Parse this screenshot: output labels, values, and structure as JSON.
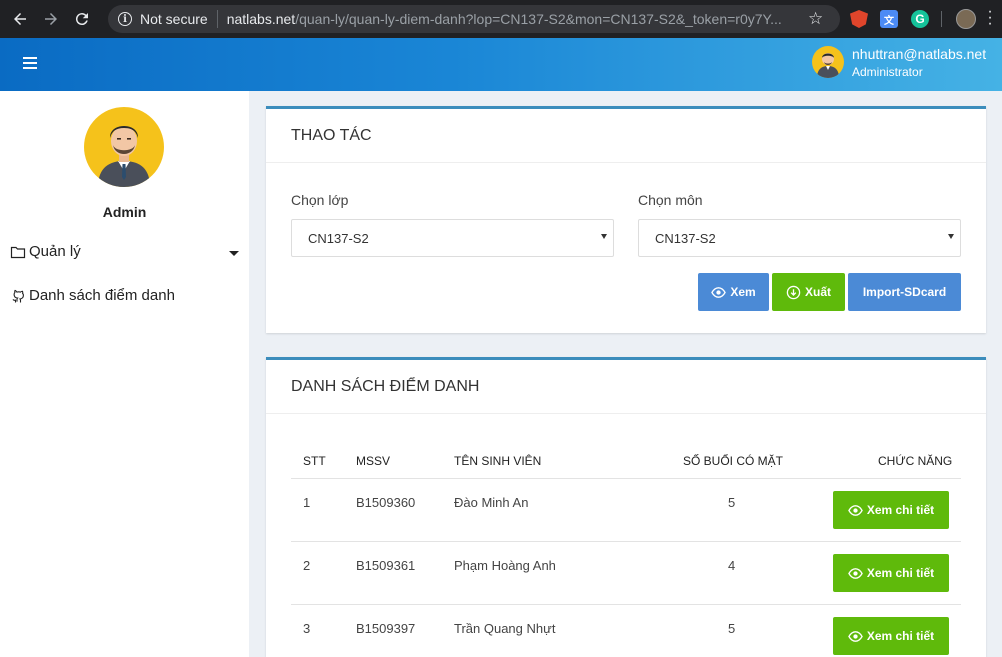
{
  "browser": {
    "security_text": "Not secure",
    "url_host": "natlabs.net",
    "url_path": "/quan-ly/quan-ly-diem-danh?lop=CN137-S2&mon=CN137-S2&_token=r0y7Y..."
  },
  "header": {
    "user_email": "nhuttran@natlabs.net",
    "user_role": "Administrator"
  },
  "sidebar": {
    "admin_label": "Admin",
    "items": [
      {
        "label": "Quản lý",
        "icon": "folder-icon"
      },
      {
        "label": "Danh sách điểm danh",
        "icon": "github-icon"
      }
    ]
  },
  "actions_panel": {
    "title": "THAO TÁC",
    "class_label": "Chọn lớp",
    "class_value": "CN137-S2",
    "subject_label": "Chọn môn",
    "subject_value": "CN137-S2",
    "view_button": "Xem",
    "export_button": "Xuất",
    "import_button": "Import-SDcard"
  },
  "list_panel": {
    "title": "DANH SÁCH ĐIỂM DANH",
    "columns": [
      "STT",
      "MSSV",
      "TÊN SINH VIÊN",
      "SỐ BUỔI CÓ MẶT",
      "CHỨC NĂNG"
    ],
    "rows": [
      {
        "stt": "1",
        "mssv": "B1509360",
        "name": "Đào Minh An",
        "present": "5",
        "action": "Xem chi tiết"
      },
      {
        "stt": "2",
        "mssv": "B1509361",
        "name": "Phạm Hoàng Anh",
        "present": "4",
        "action": "Xem chi tiết"
      },
      {
        "stt": "3",
        "mssv": "B1509397",
        "name": "Trần Quang Nhựt",
        "present": "5",
        "action": "Xem chi tiết"
      }
    ]
  },
  "colors": {
    "accent_blue": "#4b8ad6",
    "accent_green": "#5fba0b",
    "panel_border": "#3c8dbc"
  }
}
